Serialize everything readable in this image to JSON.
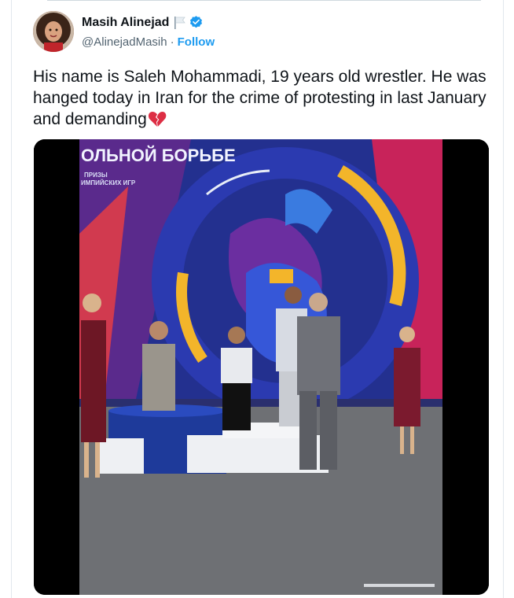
{
  "author": {
    "name": "Masih Alinejad",
    "handle": "@AlinejadMasih",
    "separator": "·",
    "follow_label": "Follow"
  },
  "tweet": {
    "text": "His name is Saleh Mohammadi, 19 years old wrestler. He was hanged today in Iran for the crime of protesting in last January and demanding"
  },
  "media": {
    "banner_text": "ОЛЬНОЙ БОРЬБЕ",
    "banner_subtext_1": "ПРИЗЫ",
    "banner_subtext_2": "ИМПИЙСКИХ ИГР"
  },
  "colors": {
    "accent": "#1d9bf0",
    "text": "#0f1419",
    "secondary": "#536471"
  },
  "icons": {
    "verified": "verified-badge-icon",
    "flag": "white-flag-icon",
    "emoji": "broken-heart-emoji"
  }
}
